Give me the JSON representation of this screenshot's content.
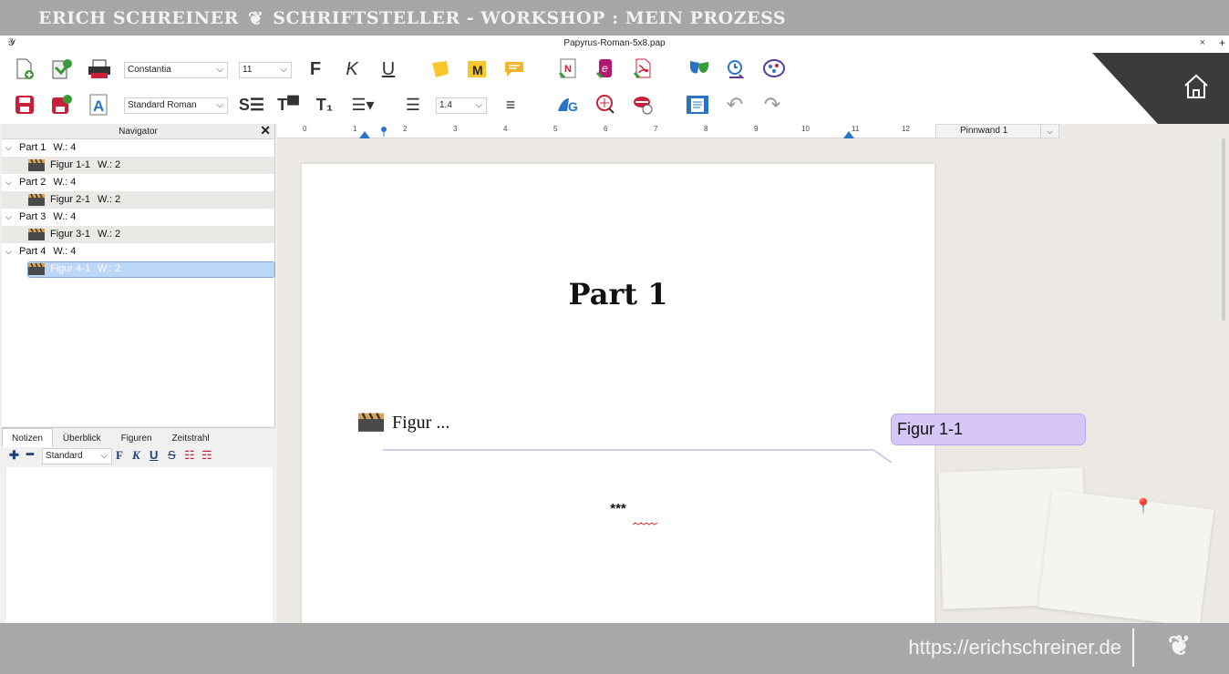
{
  "banner": {
    "left": "ERICH SCHREINER",
    "logo_glyph": "❦",
    "right": "SCHRIFTSTELLER - WORKSHOP : MEIN PROZESS"
  },
  "window": {
    "title": "Papyrus-Roman-5x8.pap",
    "close_glyph": "×",
    "plus_glyph": "+"
  },
  "toolbar": {
    "font": "Constantia",
    "size": "11",
    "bold": "F",
    "italic": "K",
    "underline": "U",
    "style": "Standard Roman",
    "line_spacing": "1.4"
  },
  "navigator": {
    "title": "Navigator",
    "close": "✕",
    "items": [
      {
        "label": "Part 1",
        "w": "W.: 4"
      },
      {
        "label": "Figur 1-1",
        "w": "W.: 2"
      },
      {
        "label": "Part 2",
        "w": "W.: 4"
      },
      {
        "label": "Figur 2-1",
        "w": "W.: 2"
      },
      {
        "label": "Part 3",
        "w": "W.: 4"
      },
      {
        "label": "Figur 3-1",
        "w": "W.: 2"
      },
      {
        "label": "Part 4",
        "w": "W.: 4"
      },
      {
        "label": "Figur 4-1",
        "w": "W.: 2"
      }
    ]
  },
  "notes": {
    "tabs": [
      "Notizen",
      "Überblick",
      "Figuren",
      "Zeitstrahl"
    ],
    "style": "Standard",
    "bold": "F",
    "italic": "K",
    "underline": "U",
    "strike": "S"
  },
  "ruler": {
    "ticks": [
      "0",
      "1",
      "2",
      "3",
      "4",
      "5",
      "6",
      "7",
      "8",
      "9",
      "10",
      "11",
      "12"
    ]
  },
  "pinnwand": {
    "label": "Pinnwand 1"
  },
  "document": {
    "title": "Part 1",
    "figure_ref": "Figur ...",
    "separator": "***"
  },
  "figure_bubble": {
    "label": "Figur 1-1"
  },
  "footer": {
    "url": "https://erichschreiner.de"
  },
  "colors": {
    "selection": "#bcd6f7",
    "bubble": "#d6c7f7",
    "accent_red": "#c8203a",
    "accent_green": "#3a9a3a",
    "accent_blue": "#2a74c8"
  }
}
